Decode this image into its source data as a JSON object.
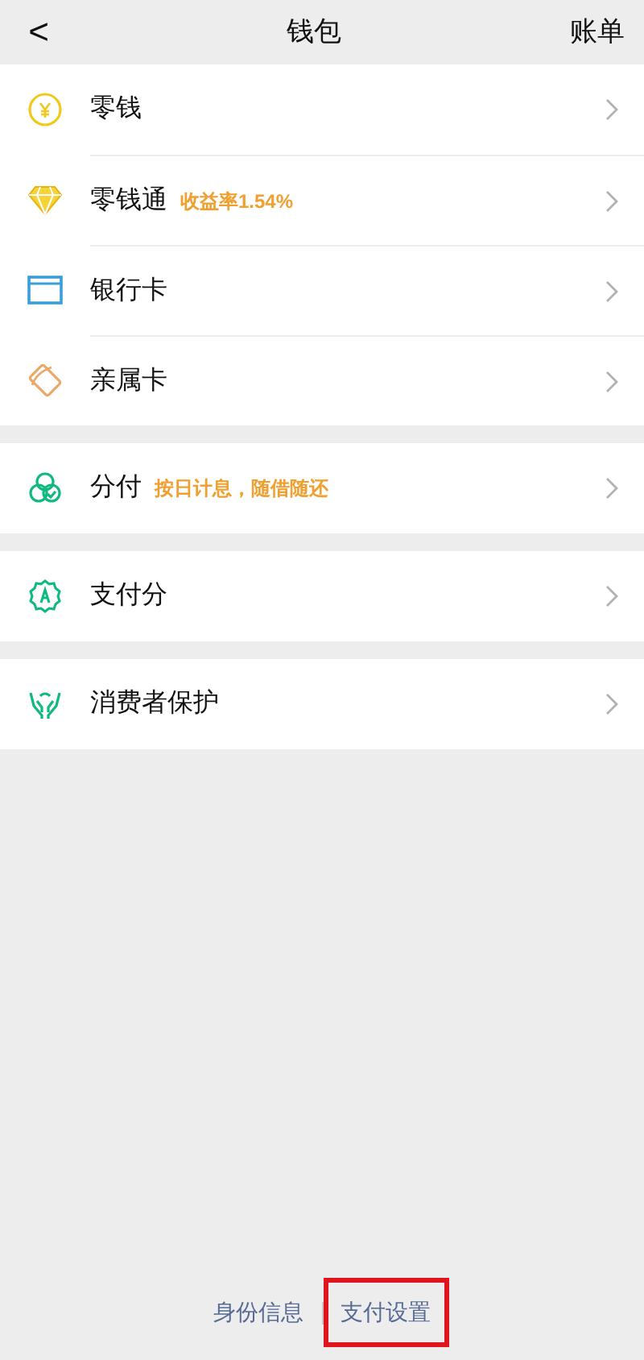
{
  "header": {
    "back": "<",
    "title": "钱包",
    "action": "账单"
  },
  "groups": [
    {
      "items": [
        {
          "kind": "coin",
          "label": "零钱"
        },
        {
          "kind": "diamond",
          "label": "零钱通",
          "note": "收益率1.54%"
        },
        {
          "kind": "card",
          "label": "银行卡"
        },
        {
          "kind": "family",
          "label": "亲属卡"
        }
      ]
    },
    {
      "items": [
        {
          "kind": "circles",
          "label": "分付",
          "note": "按日计息，随借随还"
        }
      ]
    },
    {
      "items": [
        {
          "kind": "badge",
          "label": "支付分"
        }
      ]
    },
    {
      "items": [
        {
          "kind": "hands",
          "label": "消费者保护"
        }
      ]
    }
  ],
  "footer": [
    {
      "label": "身份信息",
      "highlighted": false
    },
    {
      "label": "支付设置",
      "highlighted": true
    }
  ]
}
